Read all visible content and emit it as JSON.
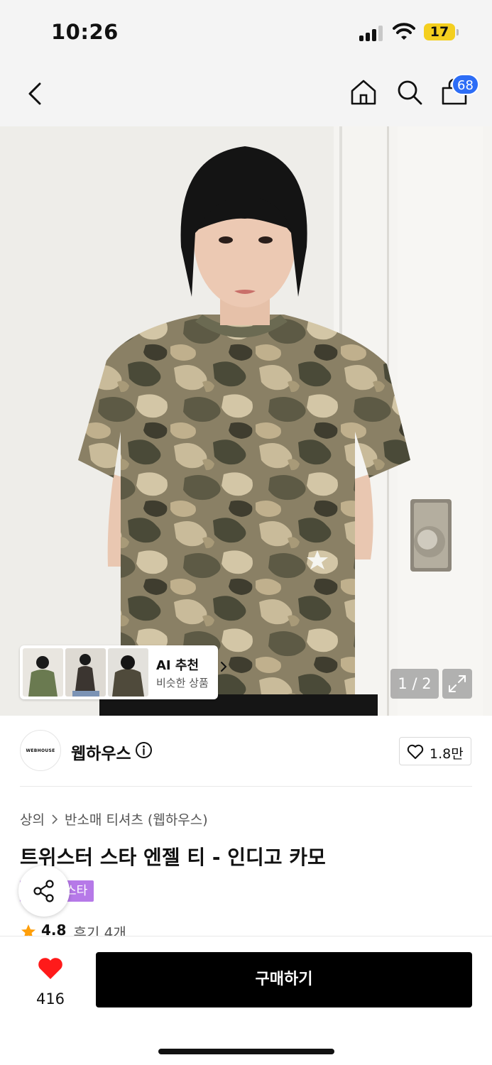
{
  "status_bar": {
    "time": "10:26",
    "battery": "17"
  },
  "nav": {
    "cart_count": "68"
  },
  "gallery": {
    "counter": "1 / 2"
  },
  "ai_recommend": {
    "title": "AI 추천",
    "subtitle": "비슷한 상품"
  },
  "brand": {
    "logo_text": "WEBHOUSE",
    "name": "웹하우스",
    "likes": "1.8만"
  },
  "breadcrumb": {
    "category": "상의",
    "subcategory": "반소매 티셔츠 (웹하우스)"
  },
  "product": {
    "title": "트위스터 스타 엔젤 티 - 인디고 카모",
    "badge": "스타",
    "rating": "4.8",
    "reviews": "후기 4개"
  },
  "bottom_bar": {
    "like_count": "416",
    "buy_label": "구매하기"
  },
  "colors": {
    "accent_blue": "#2d6df6",
    "heart_red": "#ff1a1a",
    "badge_purple": "#b679e8",
    "star_orange": "#ff9f0a"
  }
}
